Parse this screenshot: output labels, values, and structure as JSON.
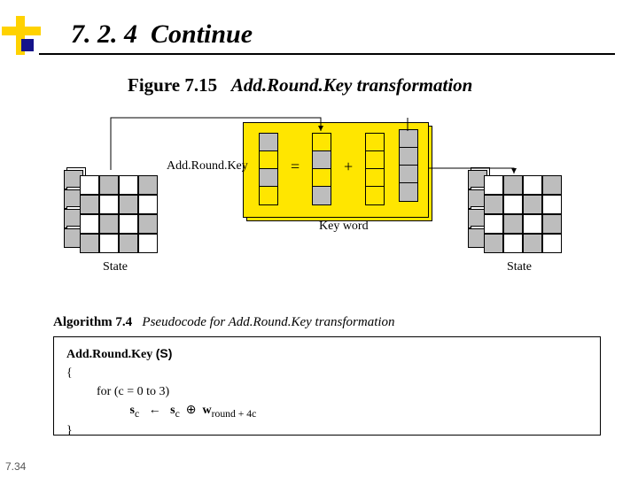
{
  "header": {
    "section_no": "7. 2. 4",
    "section_word": "Continue"
  },
  "figure": {
    "label": "Figure 7.15",
    "title": "Add.Round.Key transformation",
    "op_label": "Add.Round.Key",
    "equals": "=",
    "plus": "+",
    "keyword_label": "Key word",
    "state_left": "State",
    "state_right": "State"
  },
  "algorithm": {
    "label": "Algorithm 7.4",
    "caption": "Pseudocode for Add.Round.Key transformation",
    "fn_name": "Add.Round.Key",
    "fn_arg": "(S)",
    "open": "{",
    "loop": "for (c = 0 to 3)",
    "body_lhs": "s",
    "body_sub1": "c",
    "assign_arrow": "←",
    "rhs1": "s",
    "rhs1_sub": "c",
    "oplus": "⊕",
    "rhs2": "w",
    "rhs2_sub": "round + 4c",
    "close": "}"
  },
  "page_no": "7.34"
}
